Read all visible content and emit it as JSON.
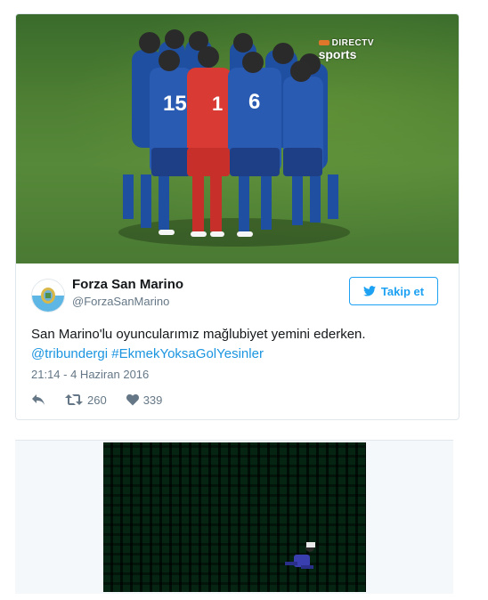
{
  "tweet": {
    "display_name": "Forza San Marino",
    "handle": "@ForzaSanMarino",
    "follow_label": "Takip et",
    "text_plain": "San Marino'lu oyuncularımız mağlubiyet yemini ederken.",
    "mention": "@tribundergi",
    "hashtag": "#EkmekYoksaGolYesinler",
    "timestamp": "21:14 - 4 Haziran 2016",
    "retweets": "260",
    "likes": "339"
  },
  "media": {
    "broadcaster_line1": "DIRECTV",
    "broadcaster_line2": "sports",
    "jersey_numbers": [
      "15",
      "6",
      "1"
    ]
  },
  "colors": {
    "accent": "#1da1f2",
    "link": "#1b95e0",
    "muted": "#657786",
    "text": "#14171a",
    "border": "#e1e8ed"
  },
  "icons": {
    "follow": "twitter-bird-icon",
    "reply": "reply-icon",
    "retweet": "retweet-icon",
    "like": "heart-icon"
  }
}
